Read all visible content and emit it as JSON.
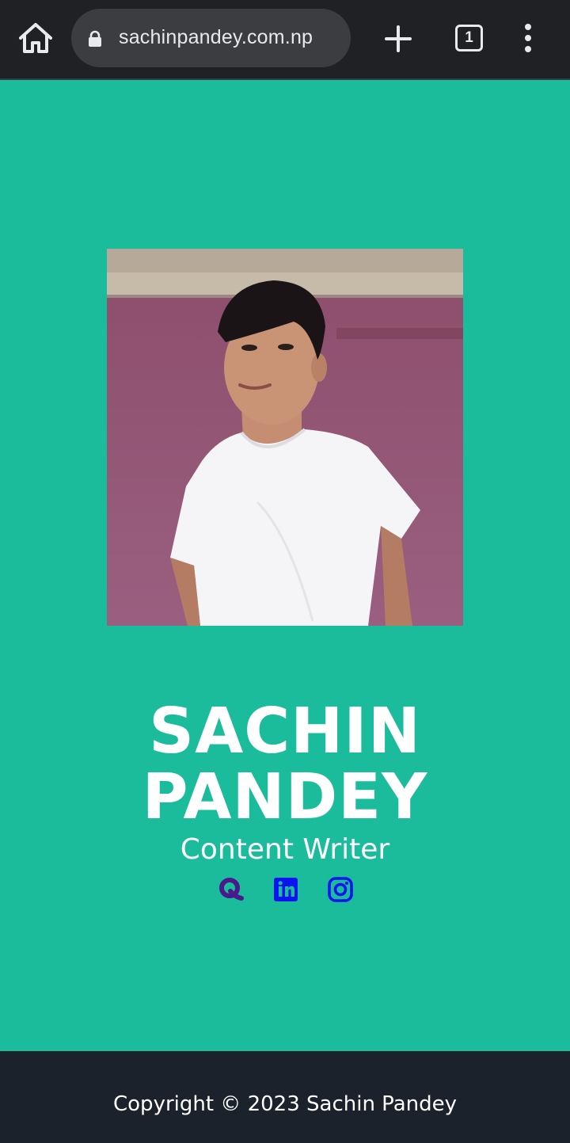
{
  "browser": {
    "url": "sachinpandey.com.np",
    "tab_count": "1",
    "icons": [
      "home-icon",
      "lock-icon",
      "plus-icon",
      "tab-switcher-icon",
      "more-vert-icon"
    ]
  },
  "profile": {
    "name_line1": "SACHIN",
    "name_line2": "PANDEY",
    "title": "Content Writer",
    "photo_alt": "Profile photo of Sachin Pandey"
  },
  "social": [
    {
      "name": "Quora",
      "icon": "quora-icon",
      "color": "#4a1a8c"
    },
    {
      "name": "LinkedIn",
      "icon": "linkedin-icon",
      "color": "#0a14f0"
    },
    {
      "name": "Instagram",
      "icon": "instagram-icon",
      "color": "#0a14f0"
    }
  ],
  "footer": {
    "copyright": "Copyright © 2023 Sachin Pandey"
  },
  "colors": {
    "page_background": "#1bbc9b",
    "footer_background": "#1c222c",
    "browser_bar": "#202124"
  }
}
